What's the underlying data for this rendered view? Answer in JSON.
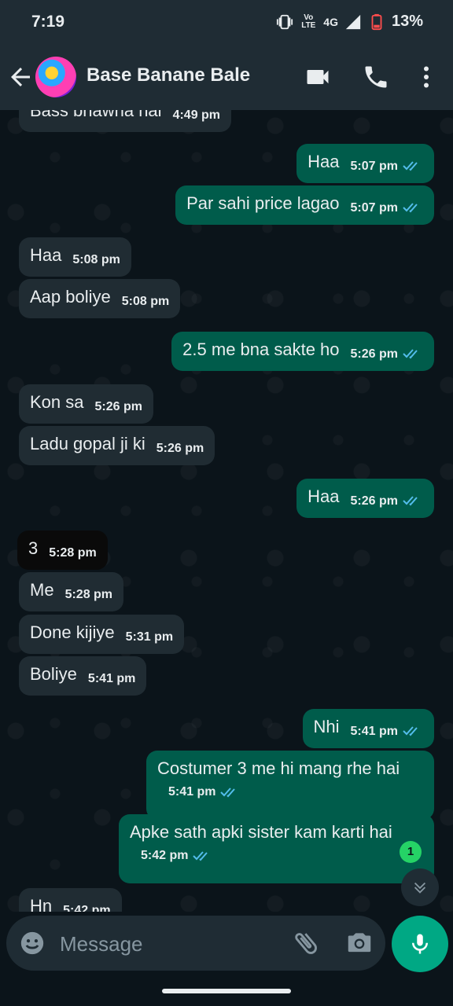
{
  "status_bar": {
    "time": "7:19",
    "network": "4G",
    "volte": "Vo LTE",
    "battery": "13%"
  },
  "header": {
    "contact_name": "Base Banane Bale",
    "icons": [
      "back-arrow-icon",
      "video-call-icon",
      "phone-icon",
      "more-vert-icon"
    ]
  },
  "messages": [
    {
      "text": "Bass bhawna hai",
      "time": "4:49 pm",
      "dir": "in"
    },
    {
      "text": "Haa",
      "time": "5:07 pm",
      "dir": "out"
    },
    {
      "text": "Par sahi price lagao",
      "time": "5:07 pm",
      "dir": "out"
    },
    {
      "text": "Haa",
      "time": "5:08 pm",
      "dir": "in"
    },
    {
      "text": "Aap boliye",
      "time": "5:08 pm",
      "dir": "in"
    },
    {
      "text": "2.5 me bna sakte ho",
      "time": "5:26 pm",
      "dir": "out"
    },
    {
      "text": "Kon sa",
      "time": "5:26 pm",
      "dir": "in"
    },
    {
      "text": "Ladu gopal ji ki",
      "time": "5:26 pm",
      "dir": "in"
    },
    {
      "text": "Haa",
      "time": "5:26 pm",
      "dir": "out"
    },
    {
      "text": "3",
      "time": "5:28 pm",
      "dir": "in"
    },
    {
      "text": "Me",
      "time": "5:28 pm",
      "dir": "in"
    },
    {
      "text": "Done kijiye",
      "time": "5:31 pm",
      "dir": "in"
    },
    {
      "text": "Boliye",
      "time": "5:41 pm",
      "dir": "in"
    },
    {
      "text": "Nhi",
      "time": "5:41 pm",
      "dir": "out"
    },
    {
      "text": "Costumer 3 me hi mang rhe hai",
      "time": "5:41 pm",
      "dir": "out"
    },
    {
      "text": "Apke sath apki sister kam  karti hai",
      "time": "5:42 pm",
      "dir": "out"
    },
    {
      "text": "Hn",
      "time": "5:42 pm",
      "dir": "in"
    }
  ],
  "unread_count": "1",
  "input": {
    "placeholder": "Message"
  },
  "colors": {
    "background": "#0b141a",
    "incoming_bubble": "#202c33",
    "outgoing_bubble": "#005c4b",
    "accent": "#00a884",
    "tick": "#53bdeb"
  }
}
